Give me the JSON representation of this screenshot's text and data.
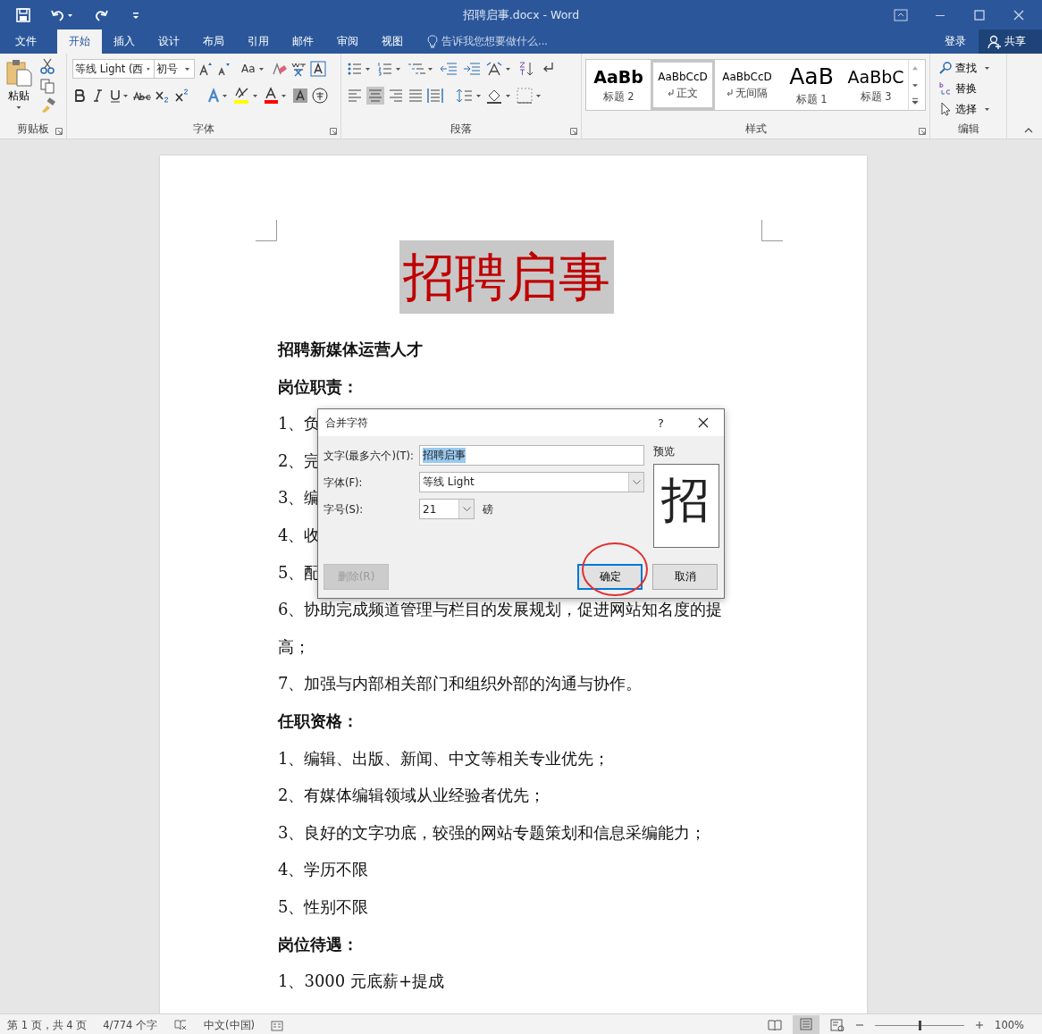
{
  "window": {
    "title": "招聘启事.docx - Word"
  },
  "tabs": [
    {
      "label": "文件",
      "selected": false,
      "kind": "file"
    },
    {
      "label": "开始",
      "selected": true,
      "kind": "tab"
    },
    {
      "label": "插入",
      "selected": false,
      "kind": "tab"
    },
    {
      "label": "设计",
      "selected": false,
      "kind": "tab"
    },
    {
      "label": "布局",
      "selected": false,
      "kind": "tab"
    },
    {
      "label": "引用",
      "selected": false,
      "kind": "tab"
    },
    {
      "label": "邮件",
      "selected": false,
      "kind": "tab"
    },
    {
      "label": "审阅",
      "selected": false,
      "kind": "tab"
    },
    {
      "label": "视图",
      "selected": false,
      "kind": "tab"
    }
  ],
  "tell_me": {
    "placeholder": "告诉我您想要做什么..."
  },
  "account": {
    "sign_in": "登录",
    "share": "共享"
  },
  "ribbon": {
    "clipboard": {
      "paste": "粘贴",
      "group": "剪贴板"
    },
    "font": {
      "font_name": "等线 Light (西",
      "font_size": "初号",
      "change_case": "Aa",
      "group": "字体"
    },
    "paragraph": {
      "group": "段落"
    },
    "styles": {
      "group": "样式",
      "items": [
        {
          "preview": "AaBb",
          "name": "标题 2",
          "kind": "heading2",
          "paragraph_mark": false,
          "selected": false
        },
        {
          "preview": "AaBbCcD",
          "name": "正文",
          "kind": "normal",
          "paragraph_mark": true,
          "selected": true
        },
        {
          "preview": "AaBbCcD",
          "name": "无间隔",
          "kind": "normal",
          "paragraph_mark": true,
          "selected": false
        },
        {
          "preview": "AaB",
          "name": "标题 1",
          "kind": "heading1",
          "paragraph_mark": false,
          "selected": false
        },
        {
          "preview": "AaBbC",
          "name": "标题 3",
          "kind": "heading3",
          "paragraph_mark": false,
          "selected": false
        }
      ]
    },
    "editing": {
      "group": "编辑",
      "items": [
        {
          "label": "查找",
          "kind": "find"
        },
        {
          "label": "替换",
          "kind": "replace"
        },
        {
          "label": "选择",
          "kind": "select"
        }
      ]
    }
  },
  "document": {
    "title": "招聘启事",
    "paragraphs": [
      {
        "kind": "heading",
        "text": "招聘新媒体运营人才"
      },
      {
        "kind": "heading",
        "text": "岗位职责："
      },
      {
        "kind": "item",
        "text": "1、负"
      },
      {
        "kind": "item",
        "text": "2、完"
      },
      {
        "kind": "item",
        "text": "3、编"
      },
      {
        "kind": "item",
        "text": "4、收"
      },
      {
        "kind": "item",
        "text": "5、配"
      },
      {
        "kind": "item",
        "text": "6、协助完成频道管理与栏目的发展规划，促进网站知名度的提高；"
      },
      {
        "kind": "item",
        "text": "7、加强与内部相关部门和组织外部的沟通与协作。"
      },
      {
        "kind": "heading",
        "text": "任职资格："
      },
      {
        "kind": "item",
        "text": "1、编辑、出版、新闻、中文等相关专业优先；"
      },
      {
        "kind": "item",
        "text": "2、有媒体编辑领域从业经验者优先；"
      },
      {
        "kind": "item",
        "text": "3、良好的文字功底，较强的网站专题策划和信息采编能力；"
      },
      {
        "kind": "item",
        "text": "4、学历不限"
      },
      {
        "kind": "item",
        "text": "5、性别不限"
      },
      {
        "kind": "heading",
        "text": "岗位待遇："
      },
      {
        "kind": "item",
        "text": "1、3000 元底薪+提成"
      }
    ]
  },
  "dialog": {
    "title": "合并字符",
    "help": "?",
    "text_label": "文字(最多六个)(T):",
    "text_value": "招聘启事",
    "font_label": "字体(F):",
    "font_value": "等线 Light",
    "size_label": "字号(S):",
    "size_value": "21",
    "size_unit": "磅",
    "preview_label": "预览",
    "preview_text": "招",
    "buttons": [
      {
        "label": "删除(R)",
        "disabled": true,
        "default": false,
        "circled": false
      },
      {
        "label": "确定",
        "disabled": false,
        "default": true,
        "circled": true
      },
      {
        "label": "取消",
        "disabled": false,
        "default": false,
        "circled": false
      }
    ]
  },
  "status_bar": {
    "page": "第 1 页，共 4 页",
    "words": "4/774 个字",
    "language": "中文(中国)",
    "zoom": "100%",
    "zoom_slider": {
      "level": 0.5
    }
  }
}
